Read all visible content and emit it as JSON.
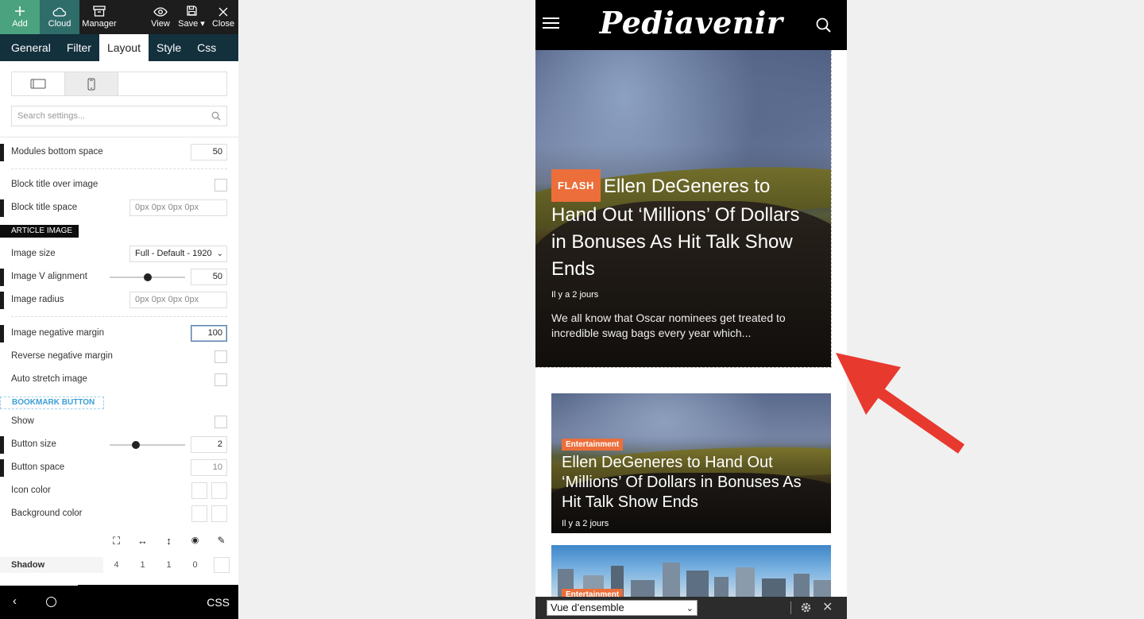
{
  "toolbar": {
    "add": "Add",
    "cloud": "Cloud",
    "manager": "Manager",
    "view": "View",
    "save": "Save",
    "close": "Close"
  },
  "tabs": [
    "General",
    "Filter",
    "Layout",
    "Style",
    "Css"
  ],
  "active_tab": "Layout",
  "search": {
    "placeholder": "Search settings..."
  },
  "settings": {
    "modules_bottom_space": {
      "label": "Modules bottom space",
      "value": "50"
    },
    "block_title_over_image": {
      "label": "Block title over image"
    },
    "block_title_space": {
      "label": "Block title space",
      "placeholder": "0px 0px 0px 0px"
    },
    "article_image_header": "ARTICLE IMAGE",
    "image_size": {
      "label": "Image size",
      "value": "Full - Default - 1920"
    },
    "image_v_alignment": {
      "label": "Image V alignment",
      "value": "50"
    },
    "image_radius": {
      "label": "Image radius",
      "placeholder": "0px 0px 0px 0px"
    },
    "image_negative_margin": {
      "label": "Image negative margin",
      "value": "100"
    },
    "reverse_negative_margin": {
      "label": "Reverse negative margin"
    },
    "auto_stretch_image": {
      "label": "Auto stretch image"
    },
    "bookmark_header": "BOOKMARK BUTTON",
    "show": {
      "label": "Show"
    },
    "button_size": {
      "label": "Button size",
      "value": "2"
    },
    "button_space": {
      "label": "Button space",
      "value": "10"
    },
    "icon_color": {
      "label": "Icon color"
    },
    "background_color": {
      "label": "Background color"
    },
    "shadow": {
      "label": "Shadow",
      "values": [
        "4",
        "1",
        "1",
        "0"
      ]
    }
  },
  "bottom_bar": {
    "css": "CSS"
  },
  "phone": {
    "logo": "Pediavenir",
    "hero": {
      "badge": "FLASH",
      "title": "Ellen DeGeneres to Hand Out ‘Millions’ Of Dollars in Bonuses As Hit Talk Show Ends",
      "date": "Il y a 2 jours",
      "excerpt": "We all know that Oscar nominees get treated to incredible swag bags every year which..."
    },
    "card1": {
      "category": "Entertainment",
      "title": "Ellen DeGeneres to Hand Out ‘Millions’ Of Dollars in Bonuses As Hit Talk Show Ends",
      "date": "Il y a 2 jours"
    },
    "card2": {
      "category": "Entertainment"
    },
    "footer_select": "Vue d’ensemble"
  },
  "colors": {
    "accent_orange": "#ec6e3a",
    "tab_bar": "#13303d",
    "add_green": "#4aa37e",
    "cloud_teal": "#2f6d6b",
    "arrow_red": "#e8392f"
  }
}
